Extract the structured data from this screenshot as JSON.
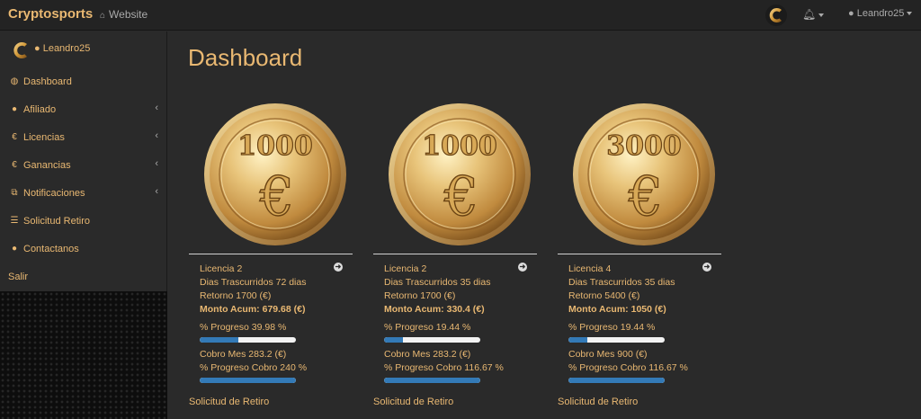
{
  "navbar": {
    "brand": "Cryptosports",
    "website_icon": "home-icon",
    "website_label": "Website",
    "bell_icon": "bell-icon",
    "user_label": "Leandro25"
  },
  "sidebar": {
    "username": "Leandro25",
    "items": [
      {
        "icon": "tachometer-icon",
        "glyph": "◍",
        "label": "Dashboard",
        "has_children": false
      },
      {
        "icon": "user-icon",
        "glyph": "●",
        "label": "Afiliado",
        "has_children": true
      },
      {
        "icon": "euro-icon",
        "glyph": "€",
        "label": "Licencias",
        "has_children": true
      },
      {
        "icon": "euro-icon",
        "glyph": "€",
        "label": "Ganancias",
        "has_children": true
      },
      {
        "icon": "notification-icon",
        "glyph": "⧉",
        "label": "Notificaciones",
        "has_children": true
      },
      {
        "icon": "list-icon",
        "glyph": "☰",
        "label": "Solicitud Retiro",
        "has_children": false
      },
      {
        "icon": "user-icon",
        "glyph": "●",
        "label": "Contactanos",
        "has_children": false
      }
    ],
    "logout": "Salir"
  },
  "main": {
    "title": "Dashboard",
    "cards": [
      {
        "coin_value": "1000",
        "licencia": "Licencia 2",
        "dias": "Dias Trascurridos 72 dias",
        "retorno": "Retorno 1700 (€)",
        "monto": "Monto Acum: 679.68 (€)",
        "progreso": "% Progreso 39.98 %",
        "progreso_value": 39.98,
        "cobro": "Cobro Mes 283.2 (€)",
        "progreso_cobro": "% Progreso Cobro 240 %",
        "progreso_cobro_value": 100,
        "solicitud": "Solicitud de Retiro"
      },
      {
        "coin_value": "1000",
        "licencia": "Licencia 2",
        "dias": "Dias Trascurridos 35 dias",
        "retorno": "Retorno 1700 (€)",
        "monto": "Monto Acum: 330.4 (€)",
        "progreso": "% Progreso 19.44 %",
        "progreso_value": 19.44,
        "cobro": "Cobro Mes 283.2 (€)",
        "progreso_cobro": "% Progreso Cobro 116.67 %",
        "progreso_cobro_value": 100,
        "solicitud": "Solicitud de Retiro"
      },
      {
        "coin_value": "3000",
        "licencia": "Licencia 4",
        "dias": "Dias Trascurridos 35 dias",
        "retorno": "Retorno 5400 (€)",
        "monto": "Monto Acum: 1050 (€)",
        "progreso": "% Progreso 19.44 %",
        "progreso_value": 19.44,
        "cobro": "Cobro Mes 900 (€)",
        "progreso_cobro": "% Progreso Cobro 116.67 %",
        "progreso_cobro_value": 100,
        "solicitud": "Solicitud de Retiro"
      }
    ]
  },
  "colors": {
    "accent": "#e9b872",
    "progress": "#337ab7",
    "background": "#2a2a2a"
  }
}
